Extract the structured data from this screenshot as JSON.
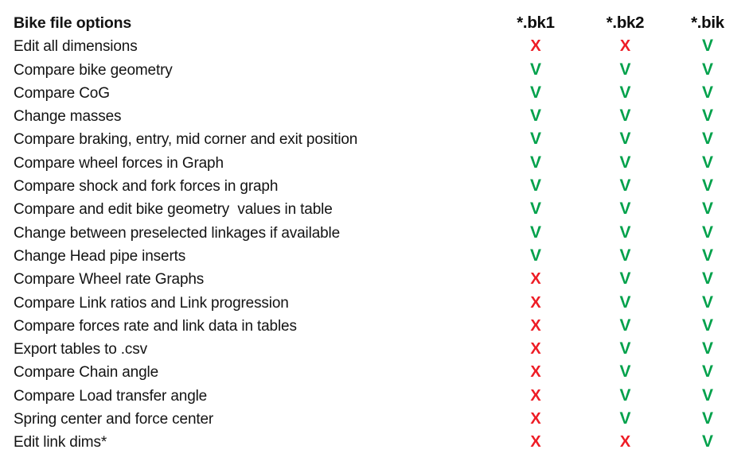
{
  "document": {
    "title": "Bike file options",
    "background_color": "#ffffff",
    "text_color": "#131313",
    "footnote_marker": "*"
  },
  "colors": {
    "supported": "#00a14b",
    "not_supported": "#ee1c25",
    "text": "#131313"
  },
  "glyphs": {
    "supported": "V",
    "not_supported": "X"
  },
  "table": {
    "header": {
      "label": "Bike file options",
      "columns": [
        {
          "key": "bk1",
          "label": "*.bk1"
        },
        {
          "key": "bk2",
          "label": "*.bk2"
        },
        {
          "key": "bik",
          "label": "*.bik"
        }
      ]
    },
    "rows": [
      {
        "label": "Edit all dimensions",
        "bk1": "X",
        "bk1_state": "no",
        "bk2": "X",
        "bk2_state": "no",
        "bik": "V",
        "bik_state": "yes"
      },
      {
        "label": "Compare bike geometry",
        "bk1": "V",
        "bk1_state": "yes",
        "bk2": "V",
        "bk2_state": "yes",
        "bik": "V",
        "bik_state": "yes"
      },
      {
        "label": "Compare CoG",
        "bk1": "V",
        "bk1_state": "yes",
        "bk2": "V",
        "bk2_state": "yes",
        "bik": "V",
        "bik_state": "yes"
      },
      {
        "label": "Change masses",
        "bk1": "V",
        "bk1_state": "yes",
        "bk2": "V",
        "bk2_state": "yes",
        "bik": "V",
        "bik_state": "yes"
      },
      {
        "label": "Compare braking, entry, mid corner and exit position",
        "bk1": "V",
        "bk1_state": "yes",
        "bk2": "V",
        "bk2_state": "yes",
        "bik": "V",
        "bik_state": "yes"
      },
      {
        "label": "Compare wheel forces in Graph",
        "bk1": "V",
        "bk1_state": "yes",
        "bk2": "V",
        "bk2_state": "yes",
        "bik": "V",
        "bik_state": "yes"
      },
      {
        "label": "Compare shock and fork forces in graph",
        "bk1": "V",
        "bk1_state": "yes",
        "bk2": "V",
        "bk2_state": "yes",
        "bik": "V",
        "bik_state": "yes"
      },
      {
        "label": "Compare and edit bike geometry  values in table",
        "bk1": "V",
        "bk1_state": "yes",
        "bk2": "V",
        "bk2_state": "yes",
        "bik": "V",
        "bik_state": "yes"
      },
      {
        "label": "Change between preselected linkages if available",
        "bk1": "V",
        "bk1_state": "yes",
        "bk2": "V",
        "bk2_state": "yes",
        "bik": "V",
        "bik_state": "yes"
      },
      {
        "label": "Change Head pipe inserts",
        "bk1": "V",
        "bk1_state": "yes",
        "bk2": "V",
        "bk2_state": "yes",
        "bik": "V",
        "bik_state": "yes"
      },
      {
        "label": "Compare Wheel rate Graphs",
        "bk1": "X",
        "bk1_state": "no",
        "bk2": "V",
        "bk2_state": "yes",
        "bik": "V",
        "bik_state": "yes"
      },
      {
        "label": "Compare Link ratios and Link progression",
        "bk1": "X",
        "bk1_state": "no",
        "bk2": "V",
        "bk2_state": "yes",
        "bik": "V",
        "bik_state": "yes"
      },
      {
        "label": "Compare forces rate and link data in tables",
        "bk1": "X",
        "bk1_state": "no",
        "bk2": "V",
        "bk2_state": "yes",
        "bik": "V",
        "bik_state": "yes"
      },
      {
        "label": "Export tables to .csv",
        "bk1": "X",
        "bk1_state": "no",
        "bk2": "V",
        "bk2_state": "yes",
        "bik": "V",
        "bik_state": "yes"
      },
      {
        "label": "Compare Chain angle",
        "bk1": "X",
        "bk1_state": "no",
        "bk2": "V",
        "bk2_state": "yes",
        "bik": "V",
        "bik_state": "yes"
      },
      {
        "label": "Compare Load transfer angle",
        "bk1": "X",
        "bk1_state": "no",
        "bk2": "V",
        "bk2_state": "yes",
        "bik": "V",
        "bik_state": "yes"
      },
      {
        "label": "Spring center and force center",
        "bk1": "X",
        "bk1_state": "no",
        "bk2": "V",
        "bk2_state": "yes",
        "bik": "V",
        "bik_state": "yes"
      },
      {
        "label": "Edit link dims*",
        "bk1": "X",
        "bk1_state": "no",
        "bk2": "X",
        "bk2_state": "no",
        "bik": "V",
        "bik_state": "yes"
      }
    ]
  }
}
